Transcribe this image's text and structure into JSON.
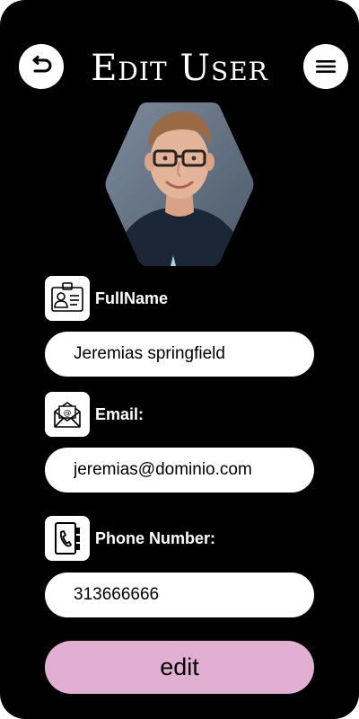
{
  "header": {
    "title": "Edit User",
    "back_icon": "back-arrow-icon",
    "menu_icon": "hamburger-menu-icon"
  },
  "avatar": {
    "shape": "hexagon"
  },
  "fields": {
    "fullname": {
      "label": "FullName",
      "value": "Jeremias springfield",
      "icon": "id-card-icon"
    },
    "email": {
      "label": "Email:",
      "value": "jeremias@dominio.com",
      "icon": "envelope-icon"
    },
    "phone": {
      "label": "Phone Number:",
      "value": "313666666",
      "icon": "phone-book-icon"
    }
  },
  "actions": {
    "edit_label": "edit"
  },
  "colors": {
    "background": "#000000",
    "surface": "#ffffff",
    "accent": "#e1afd1"
  }
}
